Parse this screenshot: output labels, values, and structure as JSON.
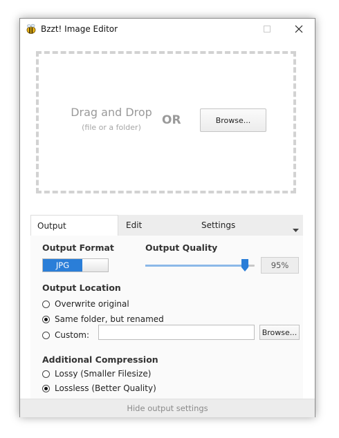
{
  "window": {
    "title": "Bzzt! Image Editor",
    "icon": "bee-icon"
  },
  "dropzone": {
    "title": "Drag and Drop",
    "subtitle": "(file or a folder)",
    "or_label": "OR",
    "browse_label": "Browse..."
  },
  "tabs": {
    "output": "Output",
    "edit": "Edit",
    "settings": "Settings"
  },
  "output_format": {
    "label": "Output Format",
    "value": "JPG"
  },
  "output_quality": {
    "label": "Output Quality",
    "value_text": "95%",
    "value": 95
  },
  "output_location": {
    "label": "Output Location",
    "options": [
      "Overwrite original",
      "Same folder, but renamed",
      "Custom:"
    ],
    "selected": "Same folder, but renamed",
    "custom_value": "",
    "browse_label": "Browse..."
  },
  "additional_compression": {
    "label": "Additional Compression",
    "options": [
      "Lossy (Smaller Filesize)",
      "Lossless (Better Quality)"
    ],
    "selected": "Lossless (Better Quality)"
  },
  "footer": {
    "label": "Hide output settings"
  },
  "colors": {
    "accent": "#2a7ed8",
    "dash": "#d2d2d2"
  }
}
